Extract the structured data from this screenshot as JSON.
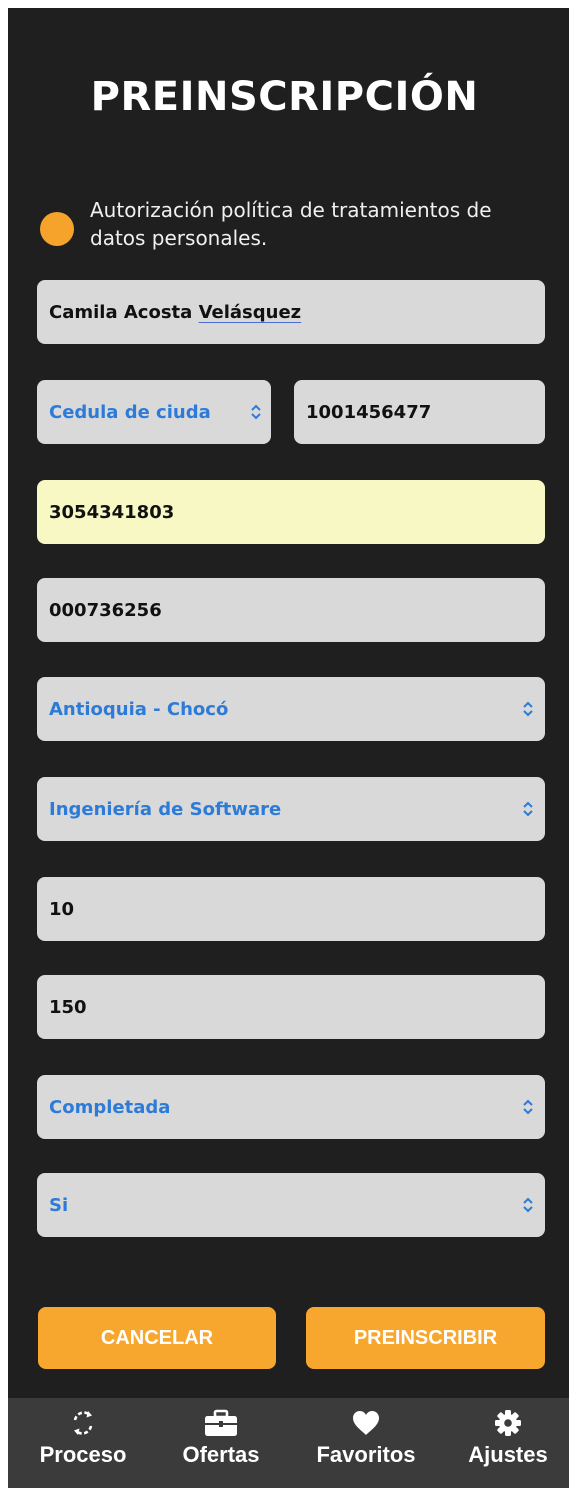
{
  "header": {
    "title": "PREINSCRIPCIÓN"
  },
  "consent": {
    "text": "Autorización política de tratamientos de datos personales.",
    "selected_color": "#f5a32a"
  },
  "form": {
    "full_name": {
      "first": "Camila Acosta ",
      "underlined": "Velásquez"
    },
    "document_type": "Cedula de ciuda",
    "document_number": "1001456477",
    "phone": "3054341803",
    "code": "000736256",
    "region": "Antioquia - Chocó",
    "program": "Ingeniería de Software",
    "semester": "10",
    "credits": "150",
    "status": "Completada",
    "answer": "Si"
  },
  "actions": {
    "cancel": "CANCELAR",
    "submit": "PREINSCRIBIR"
  },
  "tabbar": {
    "items": [
      {
        "label": "Proceso",
        "icon": "refresh-icon"
      },
      {
        "label": "Ofertas",
        "icon": "briefcase-icon"
      },
      {
        "label": "Favoritos",
        "icon": "heart-icon"
      },
      {
        "label": "Ajustes",
        "icon": "gear-icon"
      }
    ]
  },
  "colors": {
    "background": "#1f1f1f",
    "field": "#d9d9d9",
    "field_highlight": "#f7f8c4",
    "select_text": "#2d7bd8",
    "accent": "#f7a72e",
    "tabbar": "#3b3b3b"
  }
}
